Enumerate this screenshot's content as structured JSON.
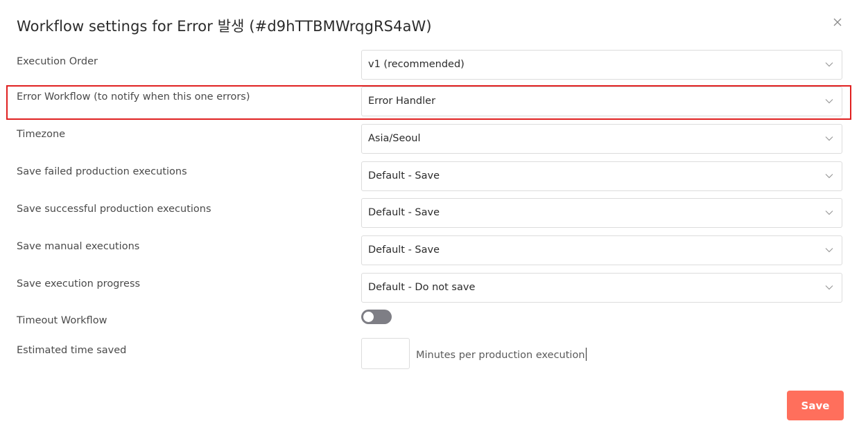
{
  "dialog": {
    "title": "Workflow settings for Error 발생 (#d9hTTBMWrqgRS4aW)"
  },
  "settings": [
    {
      "label": "Execution Order",
      "value": "v1 (recommended)"
    },
    {
      "label": "Error Workflow (to notify when this one errors)",
      "value": "Error Handler"
    },
    {
      "label": "Timezone",
      "value": "Asia/Seoul"
    },
    {
      "label": "Save failed production executions",
      "value": "Default - Save"
    },
    {
      "label": "Save successful production executions",
      "value": "Default - Save"
    },
    {
      "label": "Save manual executions",
      "value": "Default - Save"
    },
    {
      "label": "Save execution progress",
      "value": "Default - Do not save"
    }
  ],
  "timeout": {
    "label": "Timeout Workflow",
    "enabled": false
  },
  "estimated": {
    "label": "Estimated time saved",
    "value": "",
    "suffix": "Minutes per production execution"
  },
  "actions": {
    "save_label": "Save"
  },
  "colors": {
    "highlight": "#e02020",
    "save_button": "#ff6f5c",
    "toggle_off": "#7e7e85"
  },
  "icons": {
    "close": "close-icon",
    "dropdown": "chevron-down-icon"
  }
}
